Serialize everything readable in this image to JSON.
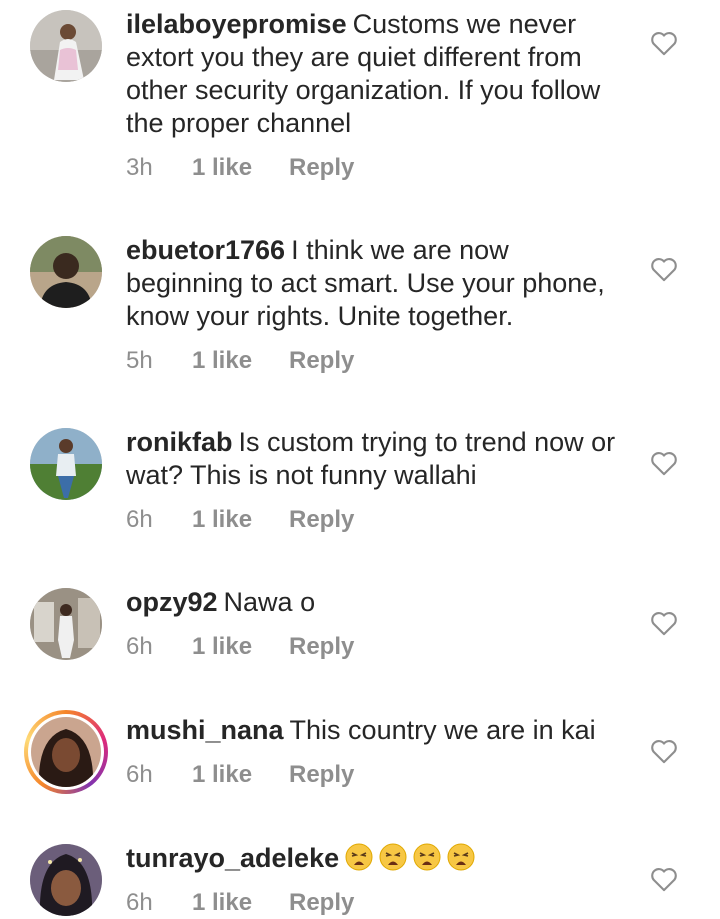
{
  "comments": [
    {
      "username": "ilelaboyepromise",
      "text": "Customs we never extort you they are quiet different from other security organization. If you follow the proper channel",
      "time": "3h",
      "likes": "1 like",
      "reply": "Reply",
      "avatar_icon": "user-avatar"
    },
    {
      "username": "ebuetor1766",
      "text": "I think we are now beginning to act smart. Use your phone, know your rights. Unite together.",
      "time": "5h",
      "likes": "1 like",
      "reply": "Reply",
      "avatar_icon": "user-avatar"
    },
    {
      "username": "ronikfab",
      "text": "Is custom trying to trend now or wat? This is not funny wallahi",
      "time": "6h",
      "likes": "1 like",
      "reply": "Reply",
      "avatar_icon": "user-avatar"
    },
    {
      "username": "opzy92",
      "text": "Nawa o",
      "time": "6h",
      "likes": "1 like",
      "reply": "Reply",
      "avatar_icon": "user-avatar"
    },
    {
      "username": "mushi_nana",
      "text": "This country we are in kai",
      "time": "6h",
      "likes": "1 like",
      "reply": "Reply",
      "avatar_icon": "user-avatar-story-ring"
    },
    {
      "username": "tunrayo_adeleke",
      "text": "😩😩😩😩",
      "time": "6h",
      "likes": "1 like",
      "reply": "Reply",
      "avatar_icon": "user-avatar"
    }
  ],
  "icons": {
    "like": "heart-outline-icon",
    "weary": "weary-face-emoji"
  },
  "colors": {
    "text": "#262626",
    "meta": "#8e8e8e",
    "heart": "#8e8e8e"
  }
}
